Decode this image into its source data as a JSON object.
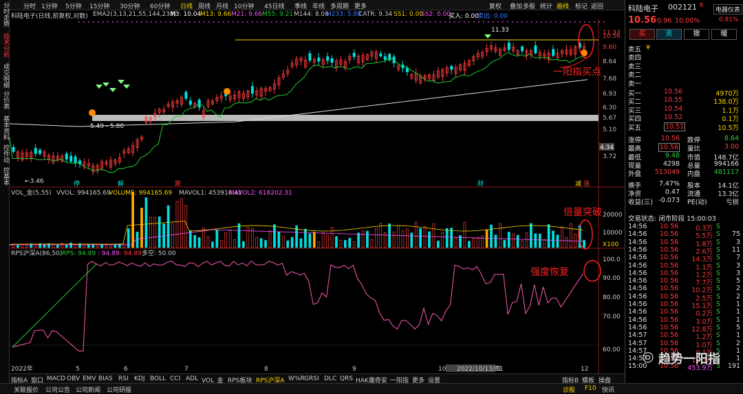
{
  "left_tabs": [
    "分时走势",
    "技术分析",
    "成交明细",
    "分价表",
    "基本资料",
    "控件动",
    "控基本"
  ],
  "toolbar": {
    "periods": [
      "分时",
      "1分钟",
      "5分钟",
      "15分钟",
      "30分钟",
      "60分钟",
      "日线",
      "周线",
      "月线",
      "10分钟",
      "45日线",
      "季线",
      "年线",
      "多周期",
      "更多"
    ],
    "right": [
      "复权",
      "叠加",
      "多股",
      "统计",
      "画线",
      "标记",
      "返回"
    ]
  },
  "info": {
    "title": "科陆电子(日线,前复权,对数)",
    "ema": "EMA2(3,13,21,55,144,233)",
    "m3": "M3: 10.04",
    "m13": "M13: 9.66",
    "m21": "M21: 9.66",
    "m55": "M55: 9.21",
    "m144": "M144: 8.08",
    "m233": "M233: 5.80",
    "catr": "CATR: 9.34",
    "ss1": "SS1: 0.00",
    "ss2": "SS2: 0.00",
    "buy": "买入: 0.00",
    "sell": "卖出: 0.00"
  },
  "price_axis": [
    "11.33",
    "10.56",
    "9.60",
    "8.64",
    "7.68",
    "6.93",
    "6.30",
    "5.67",
    "5.10",
    "4.34",
    "3.72"
  ],
  "price_labels": {
    "high": "11.33",
    "low": "←3.46",
    "gap": "5.49 - 5.80",
    "cur": "4.34"
  },
  "markers": {
    "m1": "停",
    "m2": "解",
    "m3": "跌",
    "m4": "财",
    "m5": "减",
    "m6": "涨"
  },
  "annotations": {
    "buy": "一阳指买点",
    "vol": "倍量突破",
    "rps": "强度恢复"
  },
  "vol_info": {
    "name": "VOL_金(5,55)",
    "vvol": "VVOL: 994165.69",
    "volume": "VOLUME: 994165.69",
    "mavol1": "MAVOL1: 453916.41",
    "mavol2": "MAVOL2: 618202.31"
  },
  "vol_axis": [
    "20000",
    "10000",
    "X100"
  ],
  "rps_info": {
    "name": "RPS沪深A(86,50)",
    "rps": "RPS: 94.89",
    "v2": ": 94.89",
    "v3": ": 94.89",
    "v4": "多空: 50.00"
  },
  "rps_axis": [
    "100.0",
    "90.00",
    "80.00",
    "70.00",
    "60.00"
  ],
  "months": [
    "2022年",
    "5",
    "6",
    "7",
    "8",
    "9",
    "10",
    "2022/10/13/四",
    "11",
    "12"
  ],
  "tabs": [
    "指标A",
    "窗口",
    "MACD",
    "OBV",
    "EMV",
    "BIAS",
    "RSI",
    "KDJ",
    "BOLL",
    "CCI",
    "ADL",
    "VOL_金",
    "RPS板块",
    "RPS沪深A",
    "W%R",
    "GRSI",
    "DLC",
    "QRS",
    "HAK庸奇安",
    "一阳指",
    "更多",
    "设置"
  ],
  "tabs_right": [
    "指标B",
    "模板",
    "操盘"
  ],
  "status": [
    "关联报价",
    "公司公告",
    "公司新闻",
    "公司研报"
  ],
  "status_right": [
    "诊股",
    "F10",
    "快讯"
  ],
  "panel": {
    "name": "科陆电子",
    "code": "002121",
    "r": "R",
    "tag": "电器仪表",
    "tagval": "0.81%",
    "price": "10.56",
    "chg": "0.96",
    "pct": "10.00%",
    "btns": [
      "买",
      "卖",
      "撤",
      "暖"
    ],
    "ask": [
      [
        "卖五",
        "",
        ""
      ],
      [
        "卖四",
        "",
        ""
      ],
      [
        "卖三",
        "",
        ""
      ],
      [
        "卖二",
        "",
        ""
      ],
      [
        "卖一",
        "",
        ""
      ]
    ],
    "askmark": "¥",
    "bids": [
      [
        "买一",
        "10.56",
        "4970万"
      ],
      [
        "买二",
        "10.55",
        "138.0万"
      ],
      [
        "买三",
        "10.54",
        "1.1万"
      ],
      [
        "买四",
        "10.52",
        "0.1万"
      ],
      [
        "买五",
        "10.51",
        "10.5万"
      ]
    ],
    "stats": [
      [
        "涨停",
        "10.56",
        "跌停",
        "8.64"
      ],
      [
        "最高",
        "10.56",
        "量比",
        "3.00"
      ],
      [
        "最低",
        "9.48",
        "市值",
        "148.7亿"
      ],
      [
        "现量",
        "4298",
        "总量",
        "994166"
      ],
      [
        "外盘",
        "513049",
        "内盘",
        "481117"
      ],
      [
        "换手",
        "7.47%",
        "股本",
        "14.1亿"
      ],
      [
        "净资",
        "0.47",
        "流通",
        "13.3亿"
      ],
      [
        "收益(三)",
        "-0.073",
        "PE(动)",
        "亏损"
      ]
    ],
    "state": "交易状态: 闭市阶段 15:00:03",
    "trades": [
      [
        "14:56",
        "10.56",
        "0.3万",
        "S",
        ""
      ],
      [
        "14:56",
        "10.56",
        "5.5万",
        "S",
        "75"
      ],
      [
        "14:56",
        "10.56",
        "1.8万",
        "S",
        "3"
      ],
      [
        "14:56",
        "10.56",
        "2.6万",
        "S",
        "11"
      ],
      [
        "14:56",
        "10.56",
        "14.3万",
        "S",
        "7"
      ],
      [
        "14:56",
        "10.56",
        "1.1万",
        "S",
        "3"
      ],
      [
        "14:56",
        "10.56",
        "1.2万",
        "S",
        "3"
      ],
      [
        "14:56",
        "10.56",
        "7.7万",
        "S",
        "5"
      ],
      [
        "14:56",
        "10.56",
        "10.2万",
        "S",
        "2"
      ],
      [
        "14:56",
        "10.56",
        "2.5万",
        "S",
        "2"
      ],
      [
        "14:56",
        "10.56",
        "15.1万",
        "S",
        "1"
      ],
      [
        "14:56",
        "10.56",
        "0.2万",
        "S",
        "1"
      ],
      [
        "14:56",
        "10.56",
        "3.0万",
        "S",
        "1"
      ],
      [
        "14:56",
        "10.56",
        "12.8万",
        "S",
        "5"
      ],
      [
        "14:57",
        "10.56",
        "1.2万",
        "S",
        "1"
      ],
      [
        "14:57",
        "10.56",
        "1.0万",
        "S",
        "2"
      ],
      [
        "14:57",
        "10.56",
        "0.1万",
        "S",
        "1"
      ],
      [
        "14:57",
        "10.56",
        "10.3万",
        "S",
        "1"
      ],
      [
        "15:00",
        "10.56",
        "453.9万",
        "S",
        "191"
      ]
    ],
    "watermark": "趋势一阳指"
  },
  "colors": {
    "up": "#ff3b3b",
    "down": "#00e0e0",
    "ma": "#22bb33",
    "line": "#ffffff",
    "rps": "#ff5ab4"
  }
}
